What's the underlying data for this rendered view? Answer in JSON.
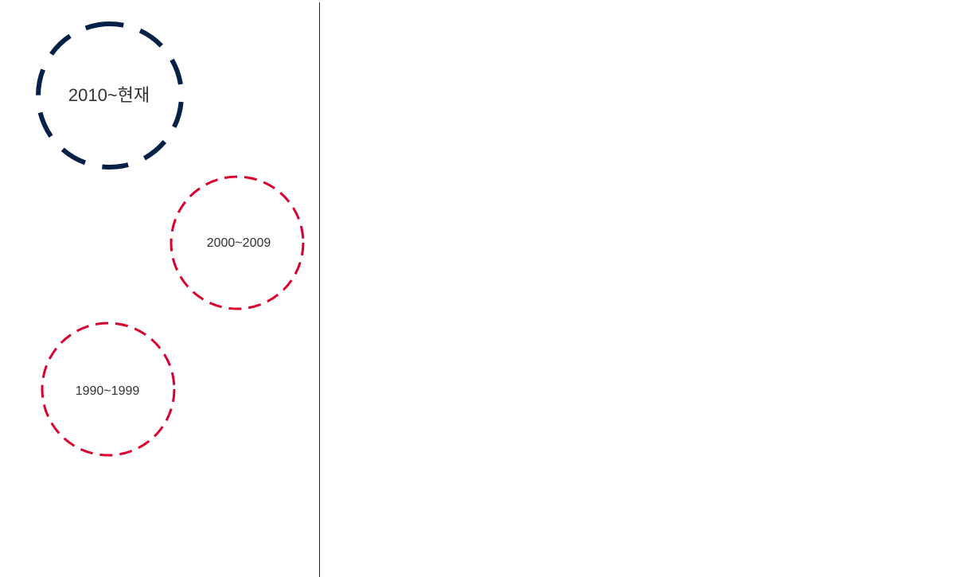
{
  "eras": [
    {
      "label": "2010~현재",
      "color": "#062148"
    },
    {
      "label": "2000~2009",
      "color": "#d9002f"
    },
    {
      "label": "1990~1999",
      "color": "#d9002f"
    }
  ]
}
